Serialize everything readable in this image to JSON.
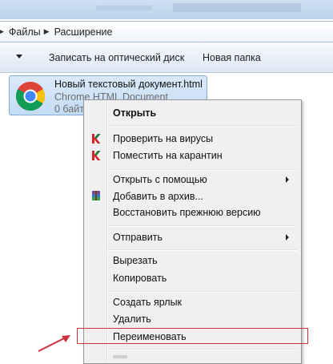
{
  "breadcrumb": {
    "items": [
      "Файлы",
      "Расширение"
    ]
  },
  "toolbar": {
    "items": [
      "Записать на оптический диск",
      "Новая папка"
    ]
  },
  "file": {
    "name": "Новый текстовый документ.html",
    "type": "Chrome HTML Document",
    "size": "0 байт",
    "icon": "chrome-icon"
  },
  "context_menu": {
    "items": [
      {
        "label": "Открыть",
        "bold": true
      },
      {
        "label": "Проверить на вирусы",
        "icon": "kaspersky-icon"
      },
      {
        "label": "Поместить на карантин",
        "icon": "kaspersky-icon"
      },
      {
        "label": "Открыть с помощью",
        "submenu": true
      },
      {
        "label": "Добавить в архив...",
        "icon": "winrar-icon"
      },
      {
        "label": "Восстановить прежнюю версию"
      },
      {
        "label": "Отправить",
        "submenu": true
      },
      {
        "label": "Вырезать"
      },
      {
        "label": "Копировать"
      },
      {
        "label": "Создать ярлык"
      },
      {
        "label": "Удалить"
      },
      {
        "label": "Переименовать",
        "highlighted": true
      }
    ]
  },
  "colors": {
    "highlight_border": "#c8303a",
    "arrow": "#c8303a",
    "selection": "#c4dcf5"
  }
}
